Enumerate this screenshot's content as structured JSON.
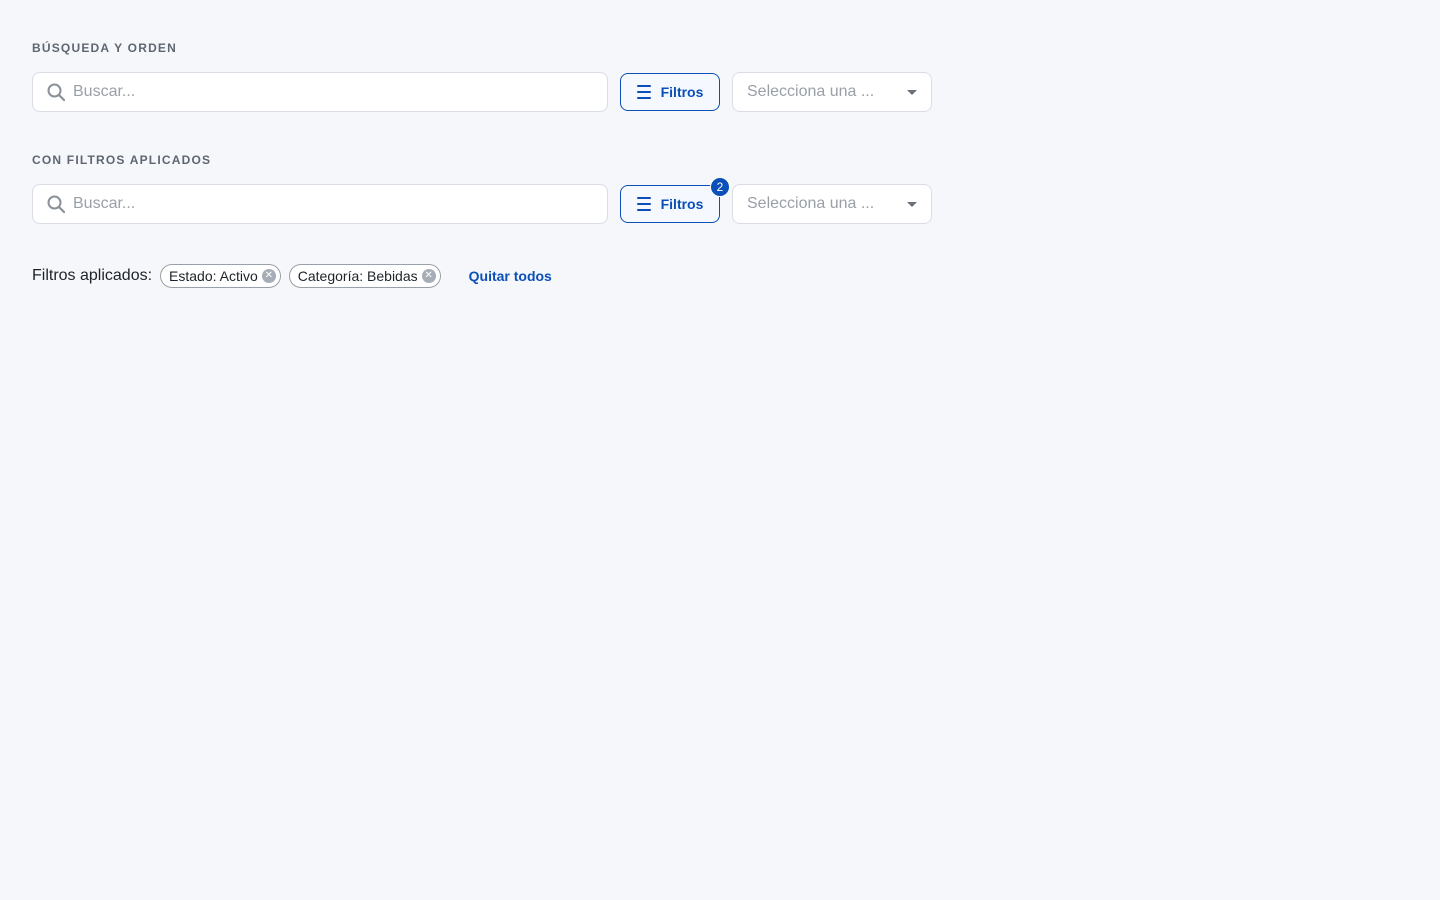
{
  "sections": [
    {
      "title": "BÚSQUEDA Y ORDEN",
      "search": {
        "placeholder": "Buscar...",
        "value": ""
      },
      "filters_button": {
        "label": "Filtros",
        "badge": null
      },
      "select": {
        "placeholder": "Selecciona una ..."
      }
    },
    {
      "title": "CON FILTROS APLICADOS",
      "search": {
        "placeholder": "Buscar...",
        "value": ""
      },
      "filters_button": {
        "label": "Filtros",
        "badge": "2"
      },
      "select": {
        "placeholder": "Selecciona una ..."
      }
    }
  ],
  "applied_filters": {
    "label": "Filtros aplicados:",
    "chips": [
      {
        "label": "Estado: Activo"
      },
      {
        "label": "Categoría: Bebidas"
      }
    ],
    "clear_all_label": "Quitar todos"
  },
  "icons": {
    "search": "search-icon",
    "filters": "menu-icon",
    "dropdown": "chevron-down-icon",
    "chip_remove": "close-icon"
  },
  "colors": {
    "accent": "#0b4fb8",
    "background": "#f5f7fb",
    "border": "#d9dde4",
    "placeholder": "#9aa0a8"
  }
}
